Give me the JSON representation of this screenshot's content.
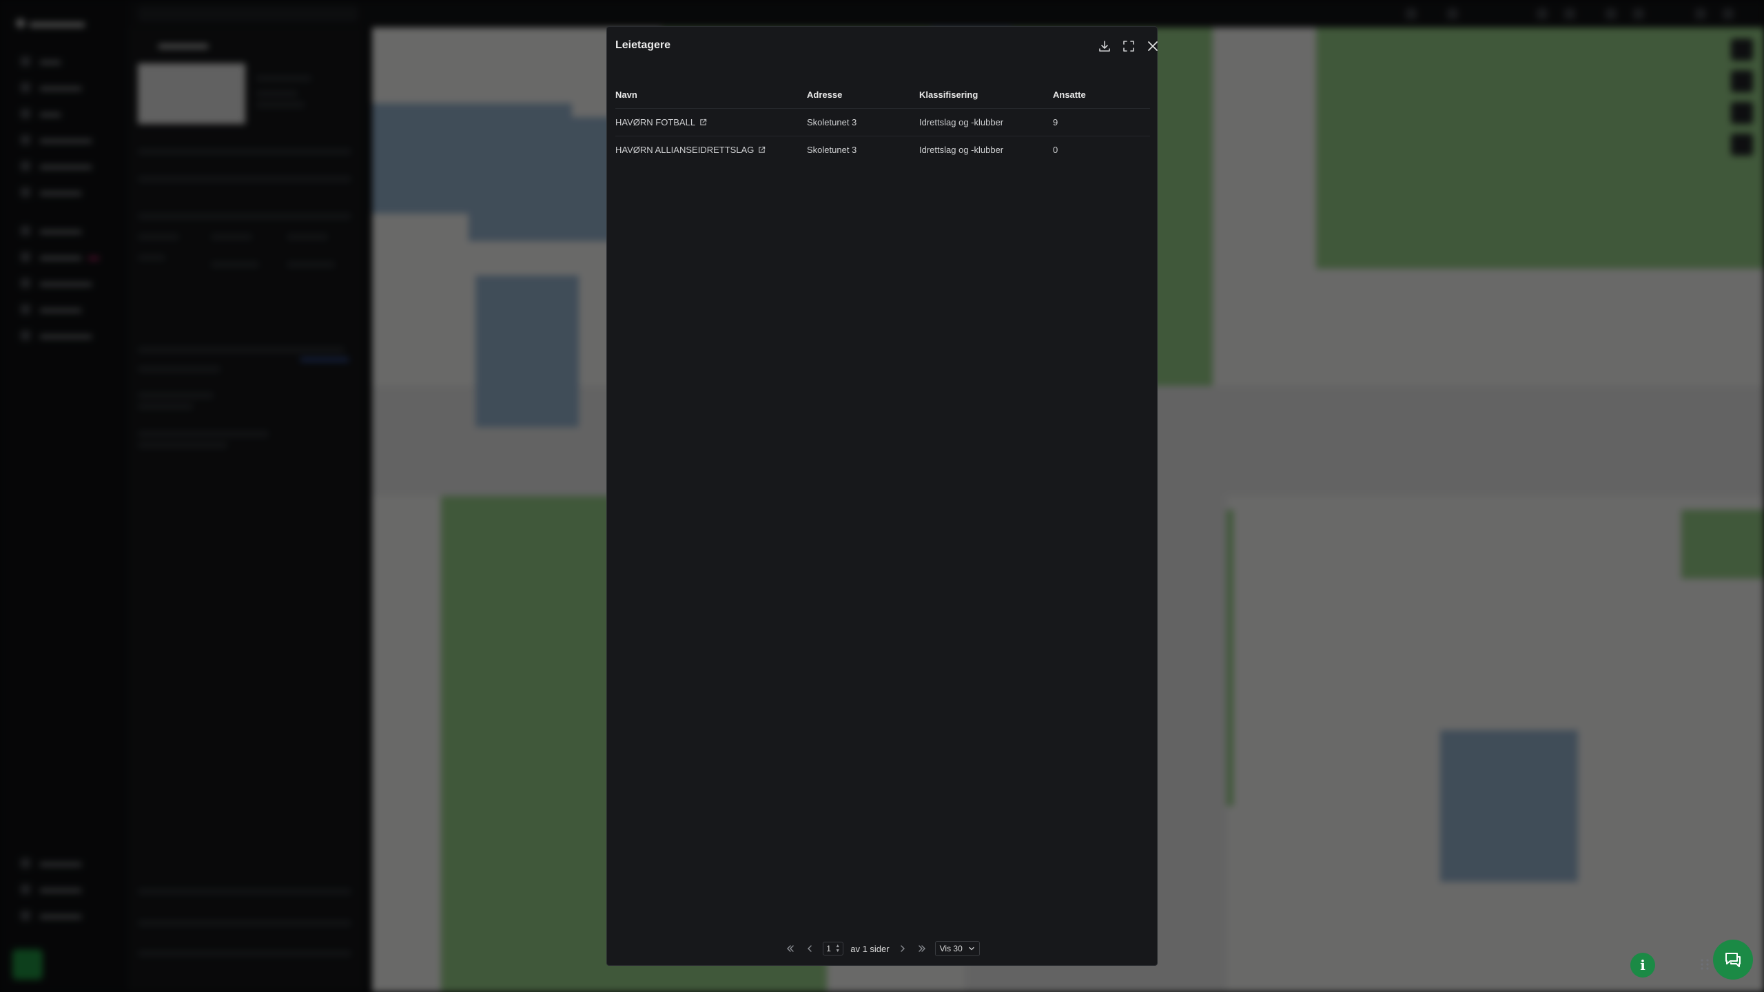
{
  "modal": {
    "title": "Leietagere",
    "columns": [
      "Navn",
      "Adresse",
      "Klassifisering",
      "Ansatte"
    ],
    "rows": [
      {
        "navn": "HAVØRN FOTBALL",
        "adresse": "Skoletunet 3",
        "klassifisering": "Idrettslag og -klubber",
        "ansatte": "9"
      },
      {
        "navn": "HAVØRN ALLIANSEIDRETTSLAG",
        "adresse": "Skoletunet 3",
        "klassifisering": "Idrettslag og -klubber",
        "ansatte": "0"
      }
    ],
    "pagination": {
      "page": "1",
      "of_label": "av 1 sider",
      "page_size_label": "Vis 30"
    }
  },
  "icons": {
    "download": "download-icon",
    "fullscreen": "expand-icon",
    "close": "close-icon",
    "external": "external-link-icon",
    "info": "info-icon",
    "chat": "chat-icon"
  },
  "colors": {
    "accent_green": "#1b8a45",
    "modal_bg": "#17181b"
  }
}
